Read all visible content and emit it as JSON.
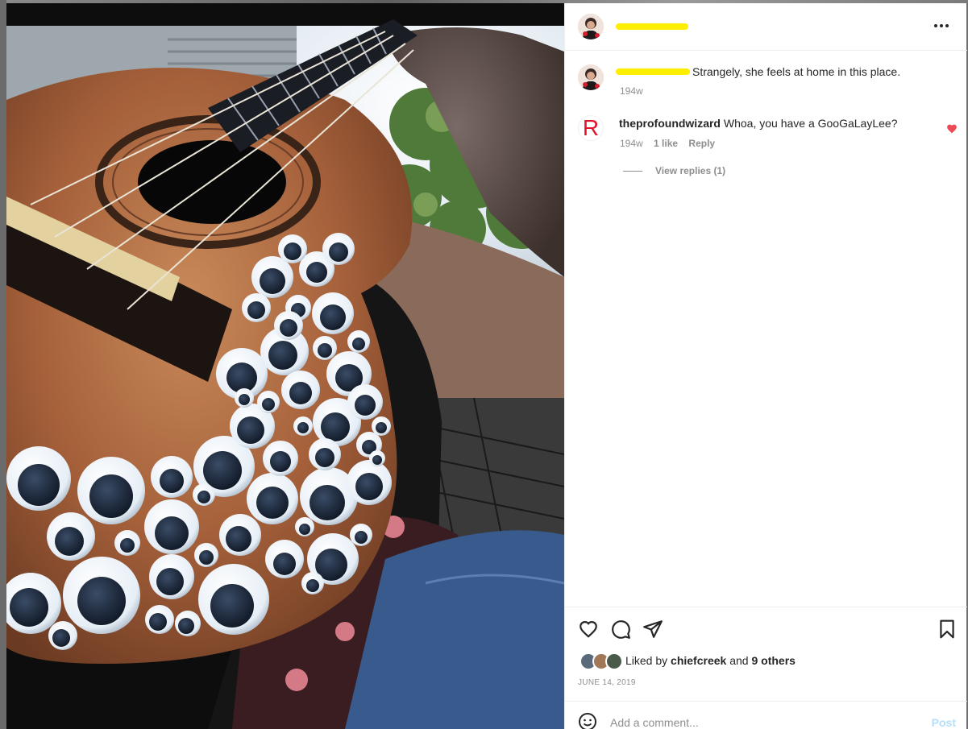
{
  "post": {
    "author_redacted": true,
    "menu_icon": "more-horizontal-icon"
  },
  "caption": {
    "author_redacted": true,
    "text": "Strangely, she feels at home in this place.",
    "age": "194w"
  },
  "comments": [
    {
      "username": "theprofoundwizard",
      "text": "Whoa, you have a GooGaLayLee?",
      "age": "194w",
      "likes": "1 like",
      "reply_label": "Reply",
      "avatar_letter": "R",
      "liked": true,
      "view_replies": "View replies (1)"
    }
  ],
  "actions": {
    "like_icon": "heart-icon",
    "comment_icon": "comment-icon",
    "share_icon": "send-icon",
    "save_icon": "bookmark-icon"
  },
  "likes": {
    "prefix": "Liked by",
    "user": "chiefcreek",
    "connector": "and",
    "others": "9 others"
  },
  "date": "JUNE 14, 2019",
  "comment_box": {
    "placeholder": "Add a comment...",
    "post_label": "Post",
    "emoji_icon": "smiley-icon"
  },
  "colors": {
    "accent_disabled": "#b2dffc",
    "heart_red": "#ed4956",
    "highlight_yellow": "#ffee00"
  }
}
